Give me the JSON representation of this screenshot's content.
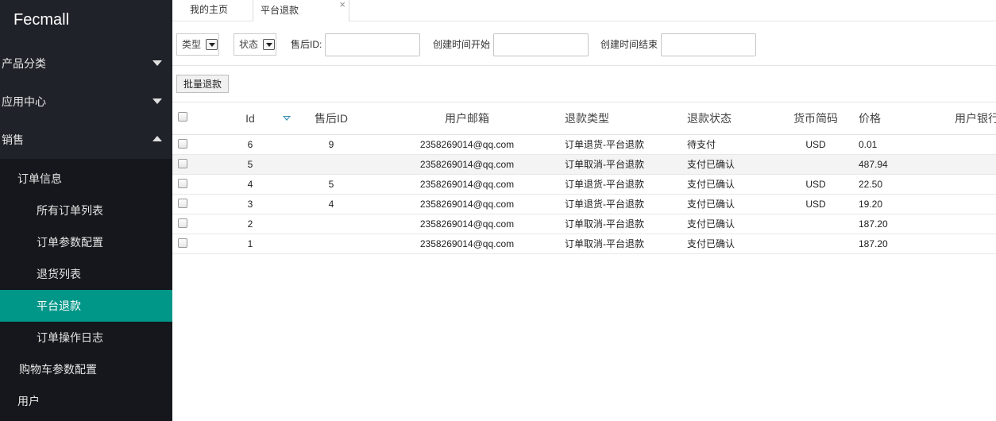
{
  "app": {
    "title": "Fecmall"
  },
  "sidebar": {
    "menus": [
      {
        "label": "产品分类",
        "expanded": false
      },
      {
        "label": "应用中心",
        "expanded": false
      },
      {
        "label": "销售",
        "expanded": true
      }
    ],
    "sub_menu": {
      "label": "订单信息",
      "expanded": true,
      "items": [
        {
          "label": "所有订单列表"
        },
        {
          "label": "订单参数配置"
        },
        {
          "label": "退货列表"
        },
        {
          "label": "平台退款",
          "active": true
        },
        {
          "label": "订单操作日志"
        }
      ]
    },
    "cart_config": "购物车参数配置",
    "user_menu": "用户",
    "colors": {
      "bg": "#1f2228",
      "active": "#009688"
    }
  },
  "tabs": {
    "home": "我的主页",
    "current": "平台退款",
    "close_icon": "×"
  },
  "filters": {
    "type_select": "类型",
    "status_select": "状态",
    "after_sale_label": "售后ID:",
    "after_sale_value": "",
    "created_start_label": "创建时间开始",
    "created_start_value": "",
    "created_end_label": "创建时间结束",
    "created_end_value": ""
  },
  "toolbar": {
    "batch_refund": "批量退款"
  },
  "table": {
    "columns": [
      "Id",
      "售后ID",
      "用户邮箱",
      "退款类型",
      "退款状态",
      "货币简码",
      "价格",
      "用户银行"
    ],
    "rows": [
      {
        "id": "6",
        "after_sale_id": "9",
        "email": "2358269014@qq.com",
        "type": "订单退货-平台退款",
        "status": "待支付",
        "currency": "USD",
        "price": "0.01"
      },
      {
        "id": "5",
        "after_sale_id": "",
        "email": "2358269014@qq.com",
        "type": "订单取消-平台退款",
        "status": "支付已确认",
        "currency": "",
        "price": "487.94"
      },
      {
        "id": "4",
        "after_sale_id": "5",
        "email": "2358269014@qq.com",
        "type": "订单退货-平台退款",
        "status": "支付已确认",
        "currency": "USD",
        "price": "22.50"
      },
      {
        "id": "3",
        "after_sale_id": "4",
        "email": "2358269014@qq.com",
        "type": "订单退货-平台退款",
        "status": "支付已确认",
        "currency": "USD",
        "price": "19.20"
      },
      {
        "id": "2",
        "after_sale_id": "",
        "email": "2358269014@qq.com",
        "type": "订单取消-平台退款",
        "status": "支付已确认",
        "currency": "",
        "price": "187.20"
      },
      {
        "id": "1",
        "after_sale_id": "",
        "email": "2358269014@qq.com",
        "type": "订单取消-平台退款",
        "status": "支付已确认",
        "currency": "",
        "price": "187.20"
      }
    ]
  }
}
